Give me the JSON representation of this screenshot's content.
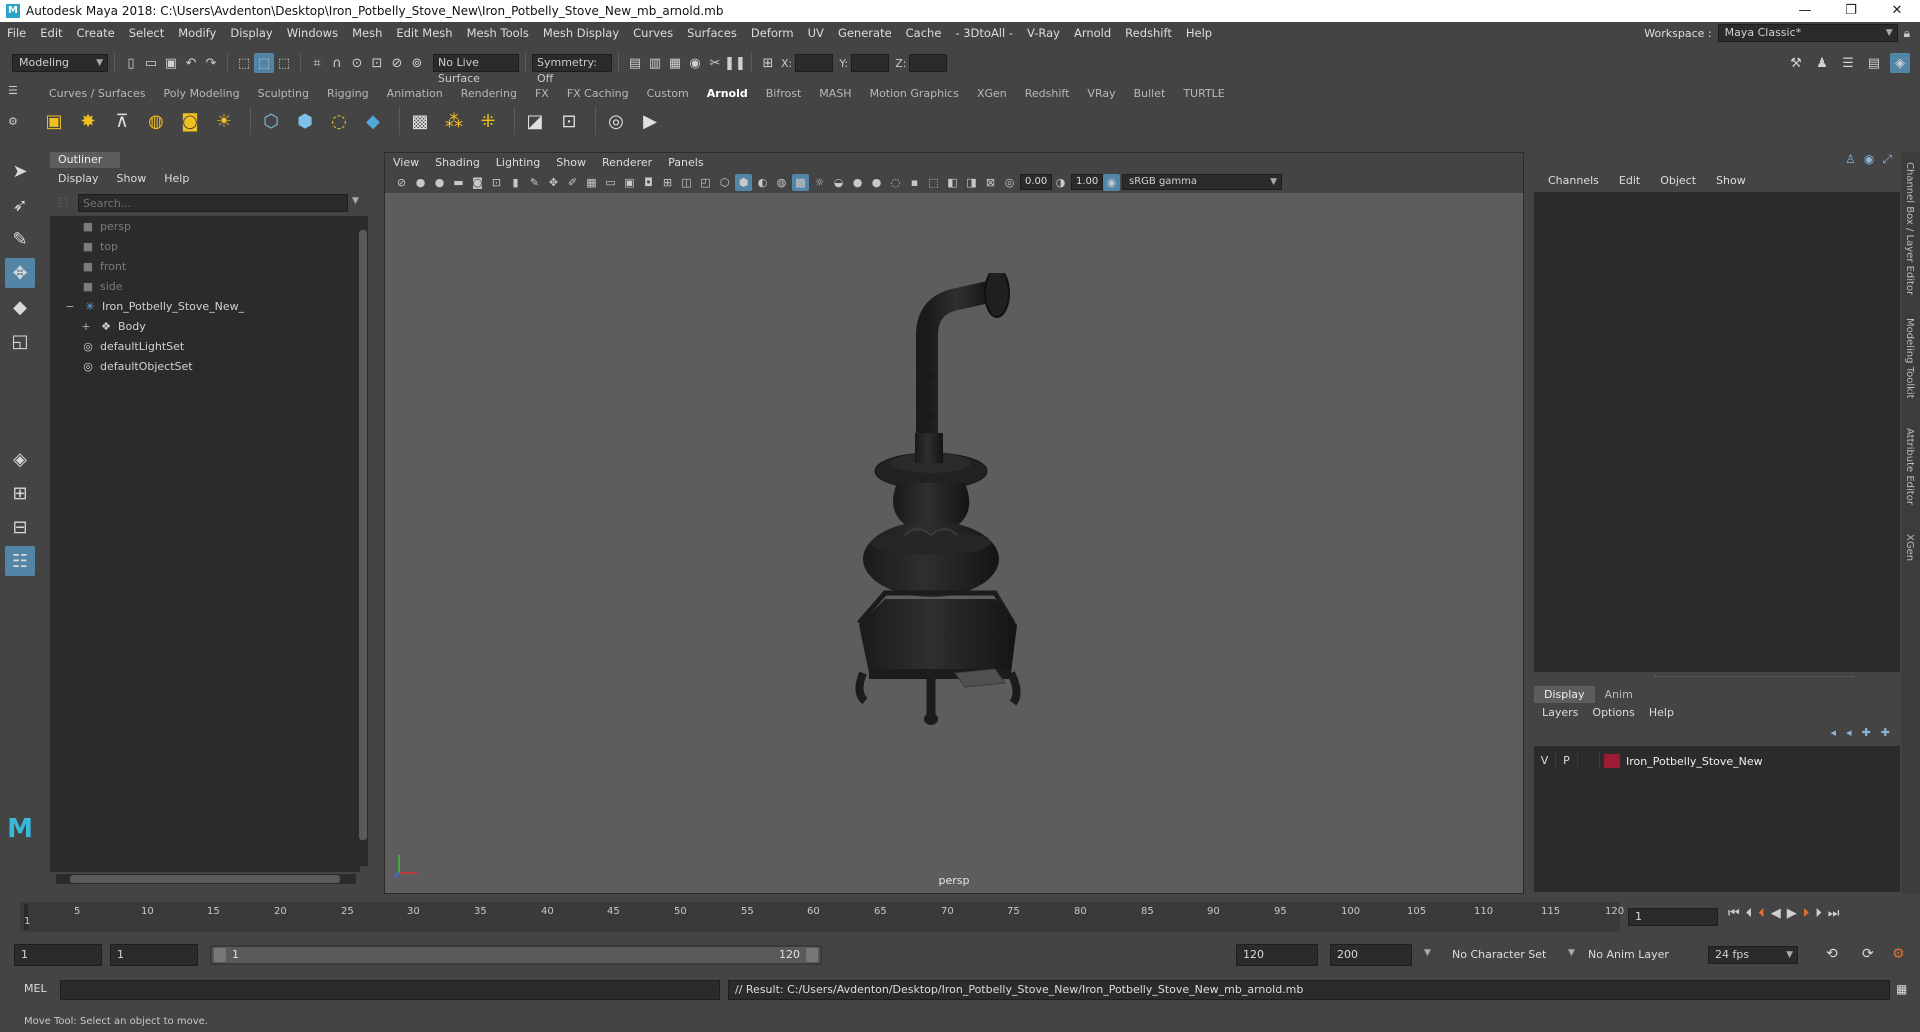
{
  "window": {
    "title": "Autodesk Maya 2018: C:\\Users\\Avdenton\\Desktop\\Iron_Potbelly_Stove_New\\Iron_Potbelly_Stove_New_mb_arnold.mb",
    "app_icon": "M"
  },
  "menubar": {
    "items": [
      "File",
      "Edit",
      "Create",
      "Select",
      "Modify",
      "Display",
      "Windows",
      "Mesh",
      "Edit Mesh",
      "Mesh Tools",
      "Mesh Display",
      "Curves",
      "Surfaces",
      "Deform",
      "UV",
      "Generate",
      "Cache",
      "- 3DtoAll -",
      "V-Ray",
      "Arnold",
      "Redshift",
      "Help"
    ],
    "workspace_label": "Workspace :",
    "workspace_value": "Maya Classic*"
  },
  "statusline": {
    "mode": "Modeling",
    "live_surface": "No Live Surface",
    "symmetry": "Symmetry: Off",
    "x_label": "X:",
    "y_label": "Y:",
    "z_label": "Z:"
  },
  "shelf": {
    "tabs": [
      "Curves / Surfaces",
      "Poly Modeling",
      "Sculpting",
      "Rigging",
      "Animation",
      "Rendering",
      "FX",
      "FX Caching",
      "Custom",
      "Arnold",
      "Bifrost",
      "MASH",
      "Motion Graphics",
      "XGen",
      "Redshift",
      "VRay",
      "Bullet",
      "TURTLE"
    ],
    "active_tab": "Arnold"
  },
  "outliner": {
    "tab": "Outliner",
    "menus": [
      "Display",
      "Show",
      "Help"
    ],
    "search_placeholder": "Search...",
    "nodes": [
      {
        "label": "persp",
        "icon": "camera-icon",
        "dim": true,
        "indent": 1
      },
      {
        "label": "top",
        "icon": "camera-icon",
        "dim": true,
        "indent": 1
      },
      {
        "label": "front",
        "icon": "camera-icon",
        "dim": true,
        "indent": 1
      },
      {
        "label": "side",
        "icon": "camera-icon",
        "dim": true,
        "indent": 1
      },
      {
        "label": "Iron_Potbelly_Stove_New_",
        "icon": "group-icon",
        "dim": false,
        "indent": 0,
        "expander": "−"
      },
      {
        "label": "Body",
        "icon": "mesh-icon",
        "dim": false,
        "indent": 1,
        "expander": "+"
      },
      {
        "label": "defaultLightSet",
        "icon": "set-icon",
        "dim": false,
        "indent": 1
      },
      {
        "label": "defaultObjectSet",
        "icon": "set-icon",
        "dim": false,
        "indent": 1
      }
    ]
  },
  "viewport": {
    "menus": [
      "View",
      "Shading",
      "Lighting",
      "Show",
      "Renderer",
      "Panels"
    ],
    "exposure": "0.00",
    "gamma": "1.00",
    "color_space": "sRGB gamma",
    "camera": "persp"
  },
  "channelbox": {
    "menus": [
      "Channels",
      "Edit",
      "Object",
      "Show"
    ],
    "side_tabs": [
      "Channel Box / Layer Editor",
      "Modeling Toolkit",
      "Attribute Editor",
      "XGen"
    ]
  },
  "layers": {
    "tabs": [
      "Display",
      "Anim"
    ],
    "active_tab": "Display",
    "menus": [
      "Layers",
      "Options",
      "Help"
    ],
    "row": {
      "v": "V",
      "p": "P",
      "name": "Iron_Potbelly_Stove_New",
      "color": "#9c1c34"
    }
  },
  "timeline": {
    "ticks": [
      "5",
      "10",
      "15",
      "20",
      "25",
      "30",
      "35",
      "40",
      "45",
      "50",
      "55",
      "60",
      "65",
      "70",
      "75",
      "80",
      "85",
      "90",
      "95",
      "100",
      "105",
      "110",
      "115",
      "120"
    ],
    "start_tick": "1",
    "current_frame": "1"
  },
  "range": {
    "start": "1",
    "playback_start": "1",
    "slider_start": "1",
    "slider_end": "120",
    "playback_end": "120",
    "end": "200",
    "character_set": "No Character Set",
    "anim_layer": "No Anim Layer",
    "fps": "24 fps"
  },
  "command": {
    "lang": "MEL",
    "result": "// Result: C:/Users/Avdenton/Desktop/Iron_Potbelly_Stove_New/Iron_Potbelly_Stove_New_mb_arnold.mb"
  },
  "helpline": {
    "text": "Move Tool: Select an object to move."
  },
  "colors": {
    "accent": "#5285a6",
    "panel": "#444444",
    "field": "#2b2b2b",
    "viewport": "#5d5d5d",
    "layer": "#9c1c34"
  }
}
